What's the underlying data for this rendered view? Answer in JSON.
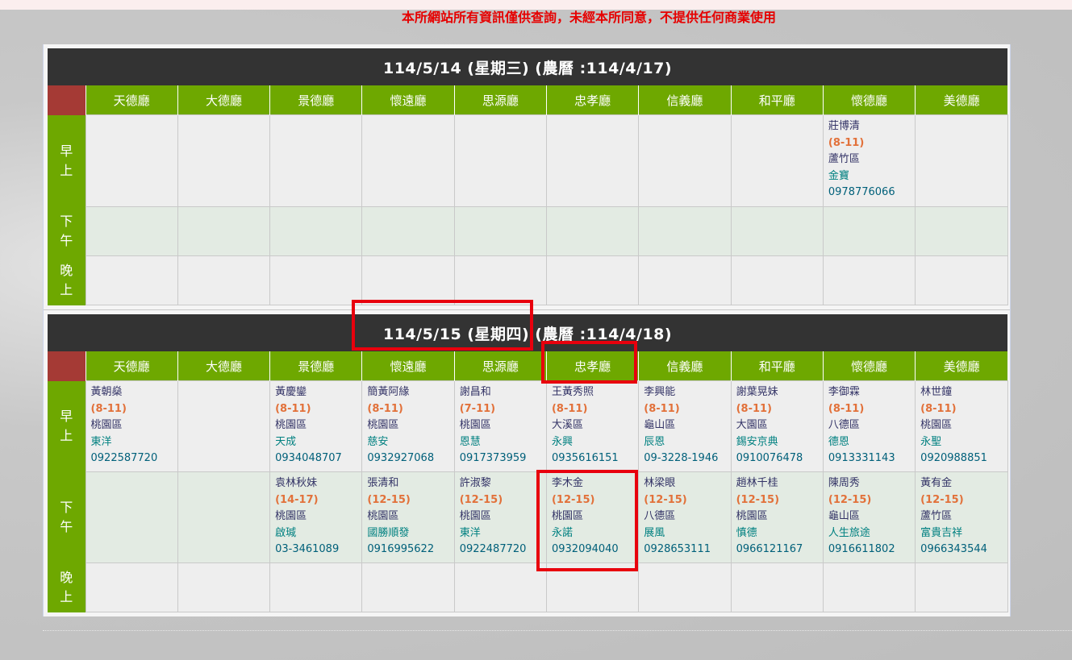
{
  "notice": "本所網站所有資訊僅供查詢，未經本所同意，不提供任何商業使用",
  "periods": {
    "morning": [
      "早",
      "上"
    ],
    "afternoon": [
      "下",
      "午"
    ],
    "night": [
      "晚",
      "上"
    ]
  },
  "halls": [
    "天德廳",
    "大德廳",
    "景德廳",
    "懷遠廳",
    "思源廳",
    "忠孝廳",
    "信義廳",
    "和平廳",
    "懷德廳",
    "美德廳"
  ],
  "day1": {
    "title": "114/5/14 (星期三) (農曆 :114/4/17)",
    "morning": [
      null,
      null,
      null,
      null,
      null,
      null,
      null,
      null,
      {
        "name": "莊博清",
        "time": "(8-11)",
        "dist": "蘆竹區",
        "shop": "金寶",
        "phone": "0978776066"
      },
      null
    ],
    "afternoon": [
      null,
      null,
      null,
      null,
      null,
      null,
      null,
      null,
      null,
      null
    ],
    "night": [
      null,
      null,
      null,
      null,
      null,
      null,
      null,
      null,
      null,
      null
    ]
  },
  "day2": {
    "title": "114/5/15 (星期四) (農曆 :114/4/18)",
    "morning": [
      {
        "name": "黃朝燊",
        "time": "(8-11)",
        "dist": "桃園區",
        "shop": "東洋",
        "phone": "0922587720"
      },
      null,
      {
        "name": "黃慶鑾",
        "time": "(8-11)",
        "dist": "桃園區",
        "shop": "天成",
        "phone": "0934048707"
      },
      {
        "name": "簡黃阿緣",
        "time": "(8-11)",
        "dist": "桃園區",
        "shop": "慈安",
        "phone": "0932927068"
      },
      {
        "name": "謝昌和",
        "time": "(7-11)",
        "dist": "桃園區",
        "shop": "恩慧",
        "phone": "0917373959"
      },
      {
        "name": "王黃秀照",
        "time": "(8-11)",
        "dist": "大溪區",
        "shop": "永興",
        "phone": "0935616151"
      },
      {
        "name": "李興能",
        "time": "(8-11)",
        "dist": "龜山區",
        "shop": "辰恩",
        "phone": "09-3228-1946"
      },
      {
        "name": "謝葉晃妹",
        "time": "(8-11)",
        "dist": "大園區",
        "shop": "錫安京典",
        "phone": "0910076478"
      },
      {
        "name": "李御霖",
        "time": "(8-11)",
        "dist": "八德區",
        "shop": "德恩",
        "phone": "0913331143"
      },
      {
        "name": "林世鐘",
        "time": "(8-11)",
        "dist": "桃園區",
        "shop": "永聖",
        "phone": "0920988851"
      }
    ],
    "afternoon": [
      null,
      null,
      {
        "name": "袁林秋妹",
        "time": "(14-17)",
        "dist": "桃園區",
        "shop": "啟瑊",
        "phone": "03-3461089"
      },
      {
        "name": "張清和",
        "time": "(12-15)",
        "dist": "桃園區",
        "shop": "國勝順發",
        "phone": "0916995622"
      },
      {
        "name": "許淑黎",
        "time": "(12-15)",
        "dist": "桃園區",
        "shop": "東洋",
        "phone": "0922487720"
      },
      {
        "name": "李木金",
        "time": "(12-15)",
        "dist": "桃園區",
        "shop": "永諾",
        "phone": "0932094040"
      },
      {
        "name": "林梁眼",
        "time": "(12-15)",
        "dist": "八德區",
        "shop": "展風",
        "phone": "0928653111"
      },
      {
        "name": "趙林千桂",
        "time": "(12-15)",
        "dist": "桃園區",
        "shop": "慎德",
        "phone": "0966121167"
      },
      {
        "name": "陳周秀",
        "time": "(12-15)",
        "dist": "龜山區",
        "shop": "人生旅途",
        "phone": "0916611802"
      },
      {
        "name": "黃有金",
        "time": "(12-15)",
        "dist": "蘆竹區",
        "shop": "富貴吉祥",
        "phone": "0966343544"
      }
    ],
    "night": [
      null,
      null,
      null,
      null,
      null,
      null,
      null,
      null,
      null,
      null
    ]
  },
  "colors": {
    "notice": "#e60000",
    "hall_header": "#6ea800",
    "corner": "#a53a35",
    "date_bar": "#333333",
    "time_text": "#e2713a",
    "highlight_box": "#e8000d"
  }
}
